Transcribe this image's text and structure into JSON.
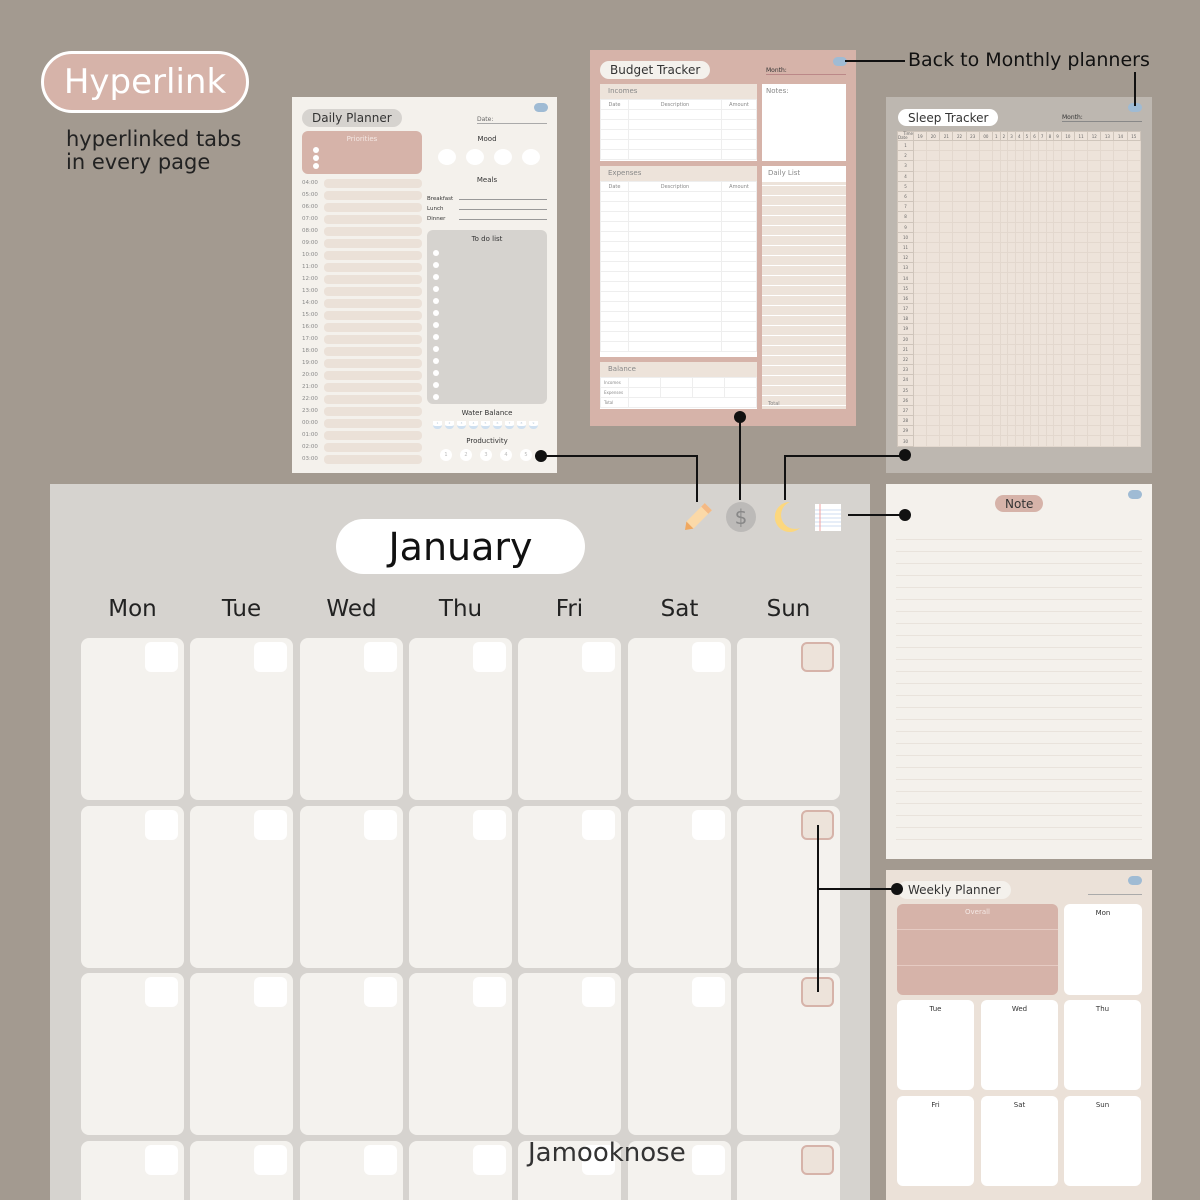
{
  "hyperlink": {
    "label": "Hyperlink",
    "caption_line1": "hyperlinked tabs",
    "caption_line2": "in every page"
  },
  "back_label": "Back to Monthly planners",
  "daily": {
    "title": "Daily Planner",
    "date_label": "Date:",
    "priorities": "Priorities",
    "mood": "Mood",
    "meals": "Meals",
    "meal_items": [
      "Breakfast",
      "Lunch",
      "Dinner"
    ],
    "todo": "To do list",
    "water": "Water Balance",
    "productivity": "Productivity",
    "productivity_levels": [
      "1",
      "2",
      "3",
      "4",
      "5"
    ],
    "water_levels": [
      "1",
      "2",
      "3",
      "4",
      "5",
      "6",
      "7",
      "8",
      "9"
    ],
    "hours": [
      "04:00",
      "05:00",
      "06:00",
      "07:00",
      "08:00",
      "09:00",
      "10:00",
      "11:00",
      "12:00",
      "13:00",
      "14:00",
      "15:00",
      "16:00",
      "17:00",
      "18:00",
      "19:00",
      "20:00",
      "21:00",
      "22:00",
      "23:00",
      "00:00",
      "01:00",
      "02:00",
      "03:00"
    ]
  },
  "budget": {
    "title": "Budget Tracker",
    "month_label": "Month:",
    "incomes": "Incomes",
    "expenses": "Expenses",
    "notes": "Notes:",
    "daily_list": "Daily List",
    "balance": "Balance",
    "cols": [
      "Date",
      "Description",
      "Amount"
    ],
    "balance_rows": [
      "Incomes",
      "Expenses",
      "Total"
    ],
    "total": "Total"
  },
  "sleep": {
    "title": "Sleep Tracker",
    "month_label": "Month:",
    "corner_time": "Time",
    "corner_date": "Date",
    "hours": [
      "19",
      "20",
      "21",
      "22",
      "23",
      "00",
      "1",
      "2",
      "3",
      "4",
      "5",
      "6",
      "7",
      "8",
      "9",
      "10",
      "11",
      "12",
      "13",
      "14",
      "15"
    ]
  },
  "note": {
    "title": "Note"
  },
  "weekly": {
    "title": "Weekly Planner",
    "overall": "Overall",
    "days": [
      "Mon",
      "Tue",
      "Wed",
      "Thu",
      "Fri",
      "Sat",
      "Sun"
    ]
  },
  "calendar": {
    "month": "January",
    "weekdays": [
      "Mon",
      "Tue",
      "Wed",
      "Thu",
      "Fri",
      "Sat",
      "Sun"
    ],
    "watermark": "Jamooknose"
  },
  "tab_icons": [
    "pencil-icon",
    "dollar-icon",
    "moon-icon",
    "notebook-icon"
  ],
  "colors": {
    "background": "#a39a90",
    "accent": "#d6b3a9",
    "paper": "#f4f1ec",
    "cloud": "#9fbbd4"
  }
}
